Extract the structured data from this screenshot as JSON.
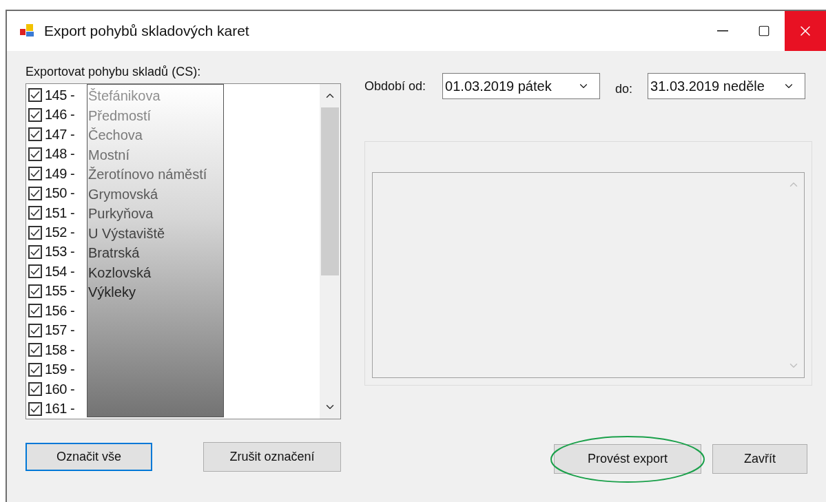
{
  "window": {
    "title": "Export pohybů skladových karet"
  },
  "list_label": "Exportovat pohybu skladů (CS):",
  "stores": [
    {
      "number": "145 -",
      "name": "Štefánikova",
      "checked": true
    },
    {
      "number": "146 -",
      "name": "Předmostí",
      "checked": true
    },
    {
      "number": "147 -",
      "name": "Čechova",
      "checked": true
    },
    {
      "number": "148 -",
      "name": "Mostní",
      "checked": true
    },
    {
      "number": "149 -",
      "name": "Žerotínovo náměstí",
      "checked": true
    },
    {
      "number": "150 -",
      "name": "Grymovská",
      "checked": true
    },
    {
      "number": "151 -",
      "name": "Purkyňova",
      "checked": true
    },
    {
      "number": "152 -",
      "name": "U Výstaviště",
      "checked": true
    },
    {
      "number": "153 -",
      "name": "Bratrská",
      "checked": true
    },
    {
      "number": "154 -",
      "name": "Kozlovská",
      "checked": true
    },
    {
      "number": "155 -",
      "name": "Výkleky",
      "checked": true
    },
    {
      "number": "156 -",
      "checked": true
    },
    {
      "number": "157 -",
      "checked": true
    },
    {
      "number": "158 -",
      "checked": true
    },
    {
      "number": "159 -",
      "checked": true
    },
    {
      "number": "160 -",
      "checked": true
    },
    {
      "number": "161 -",
      "checked": true
    }
  ],
  "period": {
    "from_label": "Období od:",
    "from_value": "01.03.2019  pátek",
    "to_label": "do:",
    "to_value": "31.03.2019 neděle"
  },
  "left_buttons": [
    {
      "label": "Označit vše",
      "focused": true
    },
    {
      "label": "Zrušit označení",
      "focused": false
    }
  ],
  "right_buttons": [
    {
      "label": "Provést export",
      "highlighted": true
    },
    {
      "label": "Zavřít",
      "highlighted": false
    }
  ]
}
